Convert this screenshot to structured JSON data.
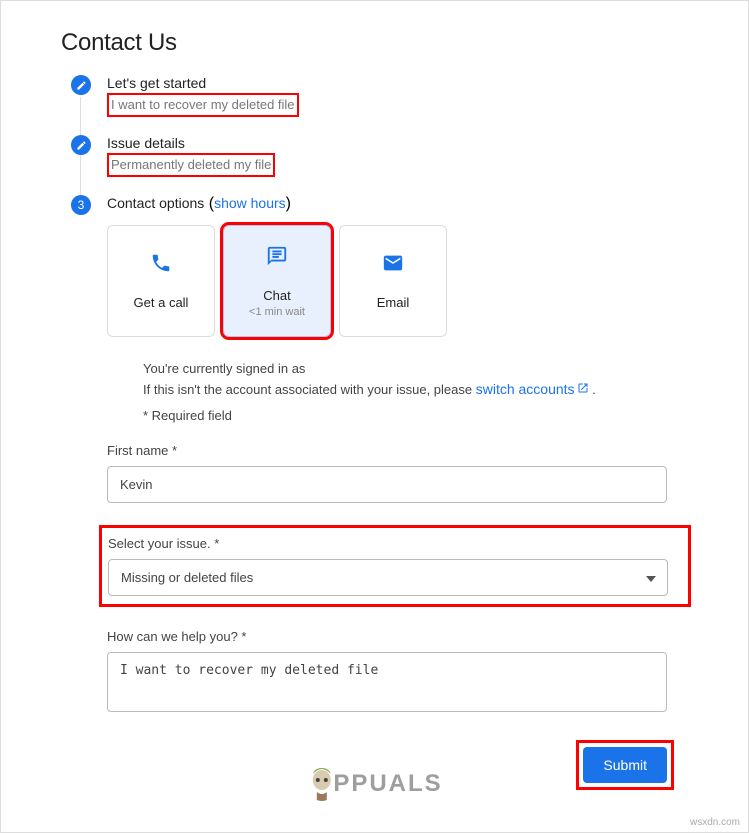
{
  "page": {
    "title": "Contact Us"
  },
  "steps": {
    "step1": {
      "title": "Let's get started",
      "subtitle": "I want to recover my deleted file"
    },
    "step2": {
      "title": "Issue details",
      "subtitle": "Permanently deleted my file"
    },
    "step3": {
      "number": "3",
      "title": "Contact options",
      "hours_link": "show hours"
    }
  },
  "contact_options": {
    "call": {
      "label": "Get a call"
    },
    "chat": {
      "label": "Chat",
      "subtext": "<1 min wait"
    },
    "email": {
      "label": "Email"
    }
  },
  "info": {
    "signed_in_prefix": "You're currently signed in as",
    "not_account": "If this isn't the account associated with your issue, please ",
    "switch_link": "switch accounts",
    "period": ".",
    "required": "* Required field"
  },
  "form": {
    "first_name_label": "First name *",
    "first_name_value": "Kevin",
    "issue_label": "Select your issue. *",
    "issue_value": "Missing or deleted files",
    "help_label": "How can we help you? *",
    "help_value": "I want to recover my deleted file",
    "submit_label": "Submit"
  },
  "watermark": {
    "text": "PPUALS"
  },
  "credit": {
    "text": "wsxdn.com"
  }
}
